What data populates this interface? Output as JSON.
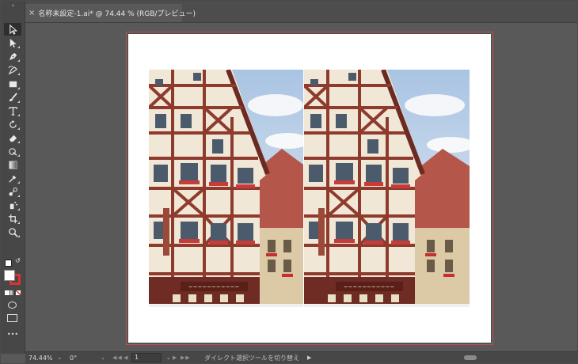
{
  "tab": {
    "close_symbol": "×",
    "title": "名称未設定-1.ai* @ 74.44 % (RGB/プレビュー)"
  },
  "toolbar": {
    "grip": "»",
    "tools": [
      {
        "name": "selection-tool-icon",
        "active": true
      },
      {
        "name": "direct-selection-tool-icon"
      },
      {
        "name": "pen-tool-icon"
      },
      {
        "name": "curvature-tool-icon"
      },
      {
        "name": "rectangle-tool-icon"
      },
      {
        "name": "paintbrush-tool-icon"
      },
      {
        "name": "type-tool-icon"
      },
      {
        "name": "rotate-tool-icon"
      },
      {
        "name": "eraser-tool-icon"
      },
      {
        "name": "shape-builder-tool-icon"
      },
      {
        "name": "gradient-tool-icon"
      },
      {
        "name": "eyedropper-tool-icon"
      },
      {
        "name": "blend-tool-icon"
      },
      {
        "name": "symbol-sprayer-tool-icon"
      },
      {
        "name": "artboard-tool-icon"
      },
      {
        "name": "zoom-tool-icon"
      }
    ],
    "more_label": "•••"
  },
  "status": {
    "zoom": "74.44%",
    "rotation": "0°",
    "artboard_index": "1",
    "message": "ダイレクト選択ツールを切り替え",
    "nav_first": "◀◀",
    "nav_prev": "◀",
    "nav_next": "▶",
    "nav_last": "▶▶",
    "dropdown": "⌄"
  },
  "colors": {
    "artboard_outline": "#c0504d",
    "fill": "#ffffff",
    "stroke": "#e03030"
  }
}
